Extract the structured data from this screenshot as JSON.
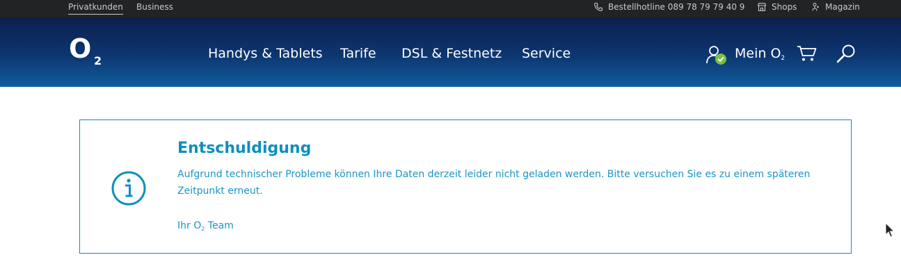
{
  "topbar": {
    "private_label": "Privatkunden",
    "business_label": "Business",
    "hotline_label": "Bestellhotline 089 78 79 79 40 9",
    "shops_label": "Shops",
    "magazine_label": "Magazin"
  },
  "nav": {
    "logo_letter": "O",
    "logo_sub": "2",
    "items": [
      {
        "label": "Handys & Tablets"
      },
      {
        "label": "Tarife"
      },
      {
        "label": "DSL & Festnetz"
      },
      {
        "label": "Service"
      }
    ],
    "account_label": "Mein O",
    "account_sub": "2",
    "status_color": "#7ac142"
  },
  "message": {
    "title": "Entschuldigung",
    "body": "Aufgrund technischer Probleme können Ihre Daten derzeit leider nicht geladen werden. Bitte versuchen Sie es zu einem späteren Zeitpunkt erneut.",
    "sign_prefix": "Ihr O",
    "sign_sub": "2",
    "sign_suffix": " Team",
    "accent_color": "#0e8fbf"
  }
}
